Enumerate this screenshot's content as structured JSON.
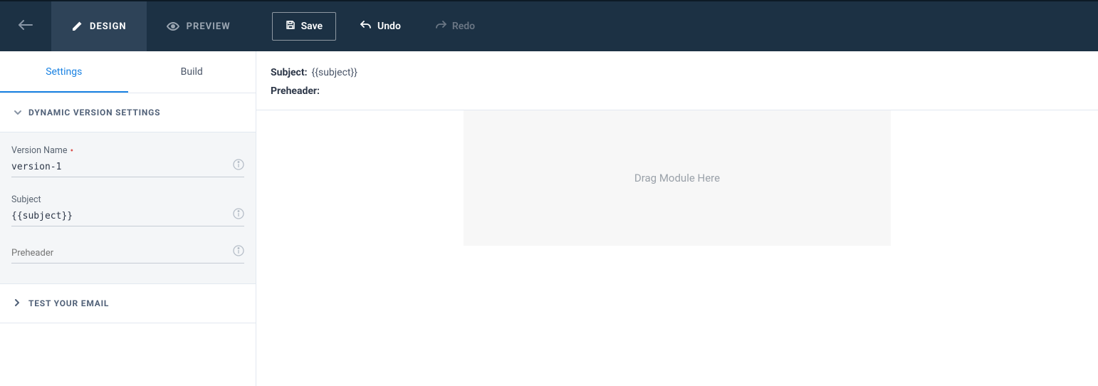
{
  "topbar": {
    "tabs": [
      {
        "label": "DESIGN",
        "active": true
      },
      {
        "label": "PREVIEW",
        "active": false
      }
    ],
    "save_label": "Save",
    "undo_label": "Undo",
    "redo_label": "Redo"
  },
  "sidebar": {
    "subtabs": [
      {
        "label": "Settings",
        "active": true
      },
      {
        "label": "Build",
        "active": false
      }
    ],
    "sections": {
      "dynamic": {
        "title": "DYNAMIC VERSION SETTINGS",
        "fields": {
          "version_name": {
            "label": "Version Name",
            "value": "version-1",
            "required": true
          },
          "subject": {
            "label": "Subject",
            "value": "{{subject}}"
          },
          "preheader": {
            "label": "Preheader",
            "value": ""
          }
        }
      },
      "test": {
        "title": "TEST YOUR EMAIL"
      }
    }
  },
  "main": {
    "subject_label": "Subject:",
    "subject_value": "{{subject}}",
    "preheader_label": "Preheader:",
    "preheader_value": "",
    "dropzone_text": "Drag Module Here"
  }
}
